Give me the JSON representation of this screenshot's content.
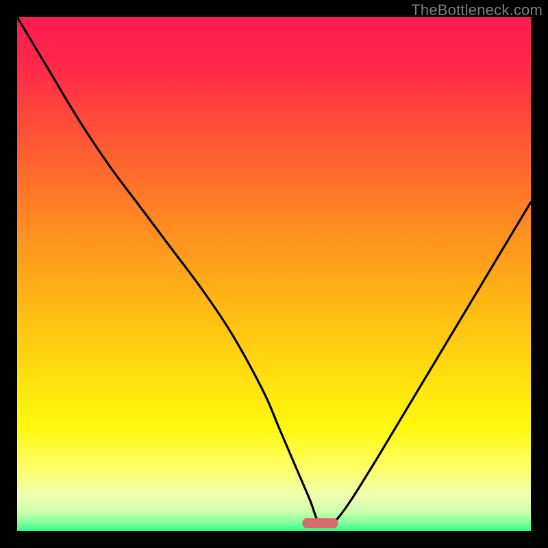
{
  "watermark": "TheBottleneck.com",
  "chart_data": {
    "type": "line",
    "title": "",
    "xlabel": "",
    "ylabel": "",
    "xlim": [
      0,
      100
    ],
    "ylim": [
      0,
      100
    ],
    "series": [
      {
        "name": "curve",
        "x": [
          0,
          6,
          12,
          18,
          24,
          30,
          36,
          42,
          48,
          51,
          54,
          57,
          58.5,
          60,
          62,
          65,
          70,
          76,
          82,
          88,
          94,
          100
        ],
        "y": [
          100,
          90,
          80,
          71,
          63,
          55,
          47,
          38,
          27,
          20,
          13,
          6,
          2,
          1,
          2,
          6,
          14,
          24,
          34,
          44,
          54,
          64
        ]
      }
    ],
    "gradient_stops": [
      {
        "offset": 0.0,
        "color": "#ff1a52"
      },
      {
        "offset": 0.1,
        "color": "#ff2a48"
      },
      {
        "offset": 0.25,
        "color": "#ff5a33"
      },
      {
        "offset": 0.4,
        "color": "#ff8a22"
      },
      {
        "offset": 0.55,
        "color": "#ffb515"
      },
      {
        "offset": 0.7,
        "color": "#ffe00e"
      },
      {
        "offset": 0.8,
        "color": "#fff80f"
      },
      {
        "offset": 0.88,
        "color": "#fdff6a"
      },
      {
        "offset": 0.93,
        "color": "#f0ffb0"
      },
      {
        "offset": 0.965,
        "color": "#c8ffac"
      },
      {
        "offset": 0.985,
        "color": "#7fff9a"
      },
      {
        "offset": 1.0,
        "color": "#2cff8c"
      }
    ],
    "marker": {
      "x": 59,
      "y": 1.5,
      "w": 7,
      "h": 2,
      "color": "#d66b6b",
      "rx": 3
    }
  }
}
